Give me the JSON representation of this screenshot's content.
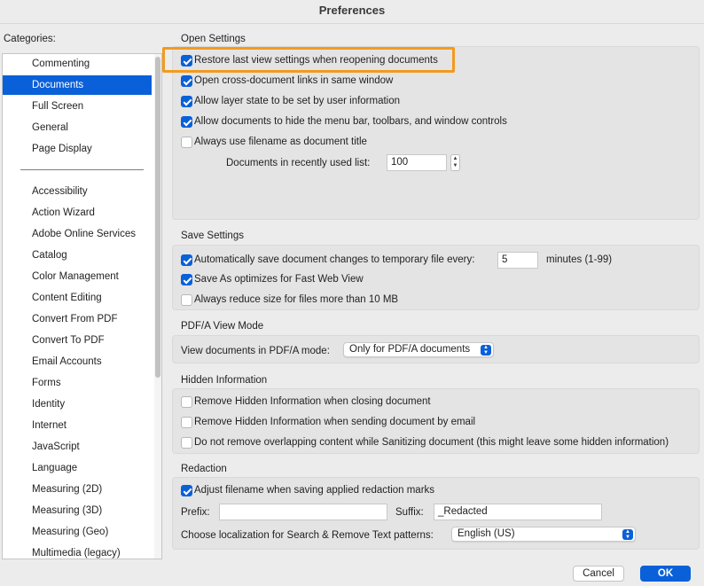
{
  "window": {
    "title": "Preferences"
  },
  "categories": {
    "label": "Categories:",
    "group1": [
      "Commenting",
      "Documents",
      "Full Screen",
      "General",
      "Page Display"
    ],
    "group2": [
      "Accessibility",
      "Action Wizard",
      "Adobe Online Services",
      "Catalog",
      "Color Management",
      "Content Editing",
      "Convert From PDF",
      "Convert To PDF",
      "Email Accounts",
      "Forms",
      "Identity",
      "Internet",
      "JavaScript",
      "Language",
      "Measuring (2D)",
      "Measuring (3D)",
      "Measuring (Geo)",
      "Multimedia (legacy)"
    ],
    "selected": "Documents"
  },
  "open_settings": {
    "title": "Open Settings",
    "options": [
      {
        "label": "Restore last view settings when reopening documents",
        "checked": true
      },
      {
        "label": "Open cross-document links in same window",
        "checked": true
      },
      {
        "label": "Allow layer state to be set by user information",
        "checked": true
      },
      {
        "label": "Allow documents to hide the menu bar, toolbars, and window controls",
        "checked": true
      },
      {
        "label": "Always use filename as document title",
        "checked": false
      }
    ],
    "recent_label": "Documents in recently used list:",
    "recent_value": "100"
  },
  "save_settings": {
    "title": "Save Settings",
    "options": [
      {
        "label": "Automatically save document changes to temporary file every:",
        "checked": true
      },
      {
        "label": "Save As optimizes for Fast Web View",
        "checked": true
      },
      {
        "label": "Always reduce size for files more than 10 MB",
        "checked": false
      }
    ],
    "autosave_value": "5",
    "autosave_unit": "minutes (1-99)"
  },
  "pdfa": {
    "title": "PDF/A View Mode",
    "label": "View documents in PDF/A mode:",
    "value": "Only for PDF/A documents"
  },
  "hidden_info": {
    "title": "Hidden Information",
    "options": [
      {
        "label": "Remove Hidden Information when closing document",
        "checked": false
      },
      {
        "label": "Remove Hidden Information when sending document by email",
        "checked": false
      },
      {
        "label": "Do not remove overlapping content while Sanitizing document (this might leave some hidden information)",
        "checked": false
      }
    ]
  },
  "redaction": {
    "title": "Redaction",
    "option": {
      "label": "Adjust filename when saving applied redaction marks",
      "checked": true
    },
    "prefix_label": "Prefix:",
    "prefix_value": "",
    "suffix_label": "Suffix:",
    "suffix_value": "_Redacted",
    "localization_label": "Choose localization for Search & Remove Text patterns:",
    "localization_value": "English (US)"
  },
  "buttons": {
    "cancel": "Cancel",
    "ok": "OK"
  },
  "colors": {
    "accent": "#0a60d8",
    "highlight": "#f39a1f",
    "background": "#ececec"
  }
}
